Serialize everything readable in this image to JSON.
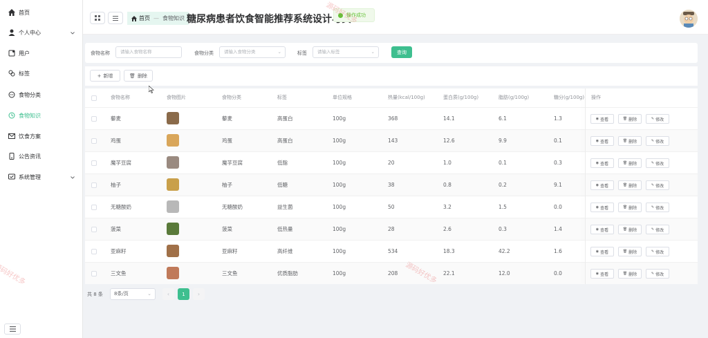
{
  "sidebar": {
    "items": [
      {
        "label": "首页",
        "icon": "home-icon"
      },
      {
        "label": "个人中心",
        "icon": "user-icon",
        "expandable": true
      },
      {
        "label": "用户",
        "icon": "user-square-icon"
      },
      {
        "label": "标签",
        "icon": "tag-icon"
      },
      {
        "label": "食物分类",
        "icon": "chat-icon"
      },
      {
        "label": "食物知识",
        "icon": "clock-icon",
        "active": true
      },
      {
        "label": "饮食方案",
        "icon": "mail-icon"
      },
      {
        "label": "公告资讯",
        "icon": "phone-icon"
      },
      {
        "label": "系统管理",
        "icon": "message-icon",
        "expandable": true
      }
    ]
  },
  "header": {
    "breadcrumb_home": "首页",
    "breadcrumb_current": "食物知识",
    "title": "糖尿病患者饮食智能推荐系统设计与实",
    "toast": "操作成功"
  },
  "search": {
    "name_label": "食物名称",
    "name_placeholder": "请输入食物名称",
    "category_label": "食物分类",
    "category_placeholder": "请输入食物分类",
    "tag_label": "标签",
    "tag_placeholder": "请输入标签",
    "query_label": "查询"
  },
  "toolbar": {
    "add_label": "新增",
    "delete_label": "删除"
  },
  "table": {
    "headers": [
      "食物名称",
      "食物图片",
      "食物分类",
      "标签",
      "单位规格",
      "热量(kcal/100g)",
      "蛋白质(g/100g)",
      "脂肪(g/100g)",
      "糖分(g/100g)",
      "操作"
    ],
    "rows": [
      {
        "name": "藜麦",
        "category": "藜麦",
        "tag": "高蛋白",
        "unit": "100g",
        "kcal": "368",
        "protein": "14.1",
        "fat": "6.1",
        "sugar": "1.3",
        "img_color": "#8a6a4a"
      },
      {
        "name": "鸡蛋",
        "category": "鸡蛋",
        "tag": "高蛋白",
        "unit": "100g",
        "kcal": "143",
        "protein": "12.6",
        "fat": "9.9",
        "sugar": "0.1",
        "img_color": "#d9a65a"
      },
      {
        "name": "魔芋豆腐",
        "category": "魔芋豆腐",
        "tag": "低脂",
        "unit": "100g",
        "kcal": "20",
        "protein": "1.0",
        "fat": "0.1",
        "sugar": "0.3",
        "img_color": "#9a8a80"
      },
      {
        "name": "柚子",
        "category": "柚子",
        "tag": "低糖",
        "unit": "100g",
        "kcal": "38",
        "protein": "0.8",
        "fat": "0.2",
        "sugar": "9.1",
        "img_color": "#c9a04a"
      },
      {
        "name": "无糖酸奶",
        "category": "无糖酸奶",
        "tag": "益生菌",
        "unit": "100g",
        "kcal": "50",
        "protein": "3.2",
        "fat": "1.5",
        "sugar": "0.0",
        "img_color": "#b8b8b8"
      },
      {
        "name": "菠菜",
        "category": "菠菜",
        "tag": "低热量",
        "unit": "100g",
        "kcal": "28",
        "protein": "2.6",
        "fat": "0.3",
        "sugar": "1.4",
        "img_color": "#5a7a3a"
      },
      {
        "name": "亚麻籽",
        "category": "亚麻籽",
        "tag": "高纤维",
        "unit": "100g",
        "kcal": "534",
        "protein": "18.3",
        "fat": "42.2",
        "sugar": "1.6",
        "img_color": "#a07048"
      },
      {
        "name": "三文鱼",
        "category": "三文鱼",
        "tag": "优质脂肪",
        "unit": "100g",
        "kcal": "208",
        "protein": "22.1",
        "fat": "12.0",
        "sugar": "0.0",
        "img_color": "#c07a5a"
      }
    ],
    "op_view": "查看",
    "op_delete": "删除",
    "op_edit": "修改"
  },
  "pagination": {
    "total": "共 8 条",
    "page_size": "8条/页",
    "current_page": "1"
  },
  "watermark": "源码好优多",
  "colors": {
    "accent": "#3ebf8f",
    "success": "#67c23a"
  }
}
